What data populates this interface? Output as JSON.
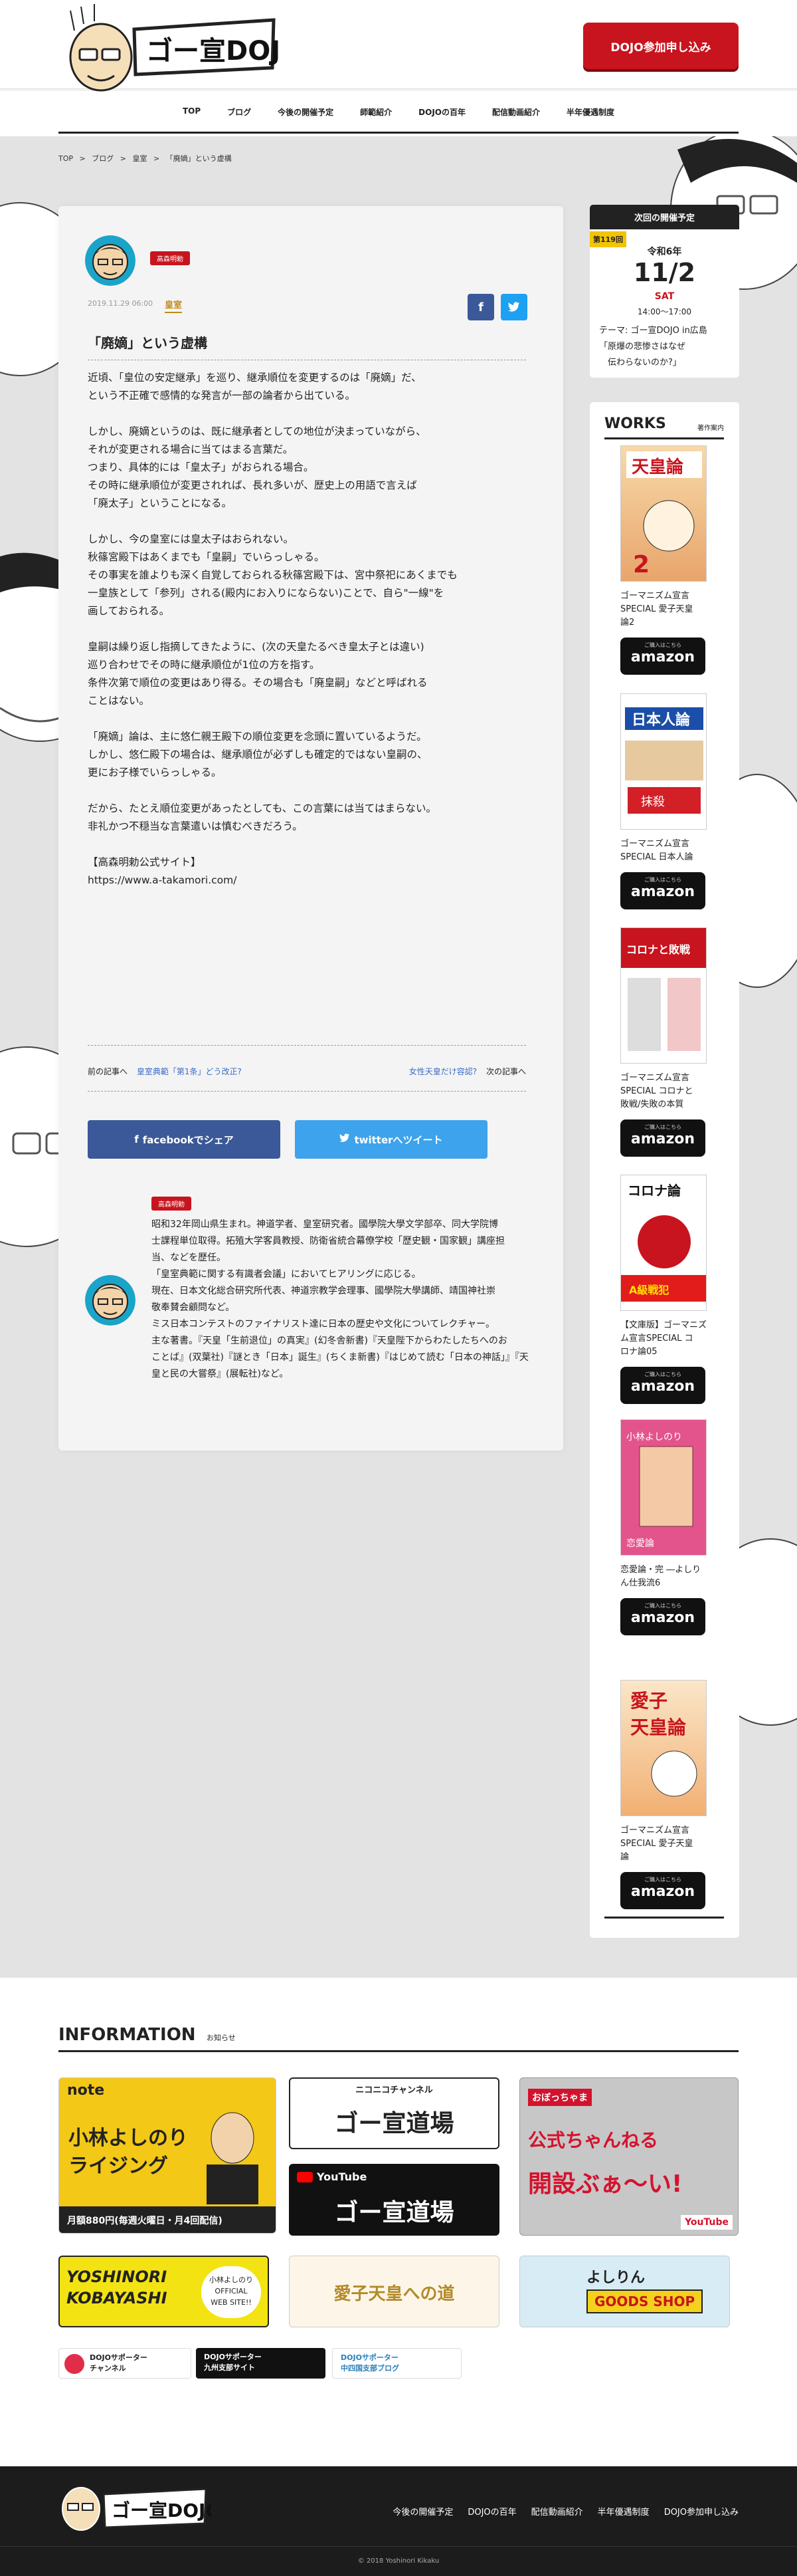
{
  "header": {
    "cta": "DOJO参加申し込み",
    "nav": [
      "TOP",
      "ブログ",
      "今後の開催予定",
      "師範紹介",
      "DOJOの百年",
      "配信動画紹介",
      "半年優遇制度"
    ]
  },
  "breadcrumb": [
    "TOP",
    ">",
    "ブログ",
    ">",
    "皇室",
    ">",
    "「廃嫡」という虚構"
  ],
  "post": {
    "tag": "高森明勅",
    "date": "2019.11.29 06:00",
    "category": "皇室",
    "title": "「廃嫡」という虚構",
    "paragraphs": [
      "近頃、「皇位の安定継承」を巡り、継承順位を変更するのは「廃嫡」だ、\nという不正確で感情的な発言が一部の論者から出ている。",
      "しかし、廃嫡というのは、既に継承者としての地位が決まっていながら、\nそれが変更される場合に当てはまる言葉だ。\nつまり、具体的には「皇太子」がおられる場合。\nその時に継承順位が変更されれば、長れ多いが、歴史上の用語で言えば\n「廃太子」ということになる。",
      "しかし、今の皇室には皇太子はおられない。\n秋篠宮殿下はあくまでも「皇嗣」でいらっしゃる。\nその事実を誰よりも深く自覚しておられる秋篠宮殿下は、宮中祭祀にあくまでも\n一皇族として「参列」される(殿内にお入りにならない)ことで、自ら\"一線\"を\n画しておられる。",
      "皇嗣は繰り返し指摘してきたように、(次の天皇たるべき皇太子とは違い)\n巡り合わせでその時に継承順位が1位の方を指す。\n条件次第で順位の変更はあり得る。その場合も「廃皇嗣」などと呼ばれる\nことはない。",
      "「廃嫡」論は、主に悠仁親王殿下の順位変更を念頭に置いているようだ。\nしかし、悠仁殿下の場合は、継承順位が必ずしも確定的ではない皇嗣の、\n更にお子様でいらっしゃる。",
      "だから、たとえ順位変更があったとしても、この言葉には当てはまらない。\n非礼かつ不穏当な言葉遣いは慎むべきだろう。",
      "【高森明勅公式サイト】\nhttps://www.a-takamori.com/"
    ],
    "prev_label": "前の記事へ",
    "prev_link": "皇室典範「第1条」どう改正?",
    "next_link": "女性天皇だけ容認?",
    "next_label": "次の記事へ",
    "share_fb": "facebookでシェア",
    "share_tw": "twitterへツイート",
    "author_tag": "高森明勅",
    "author_bio": "昭和32年岡山県生まれ。神道学者、皇室研究者。國學院大學文学部卒、同大学院博\n士課程単位取得。拓殖大学客員教授、防衛省統合幕僚学校「歴史観・国家観」講座担\n当、などを歴任。\n「皇室典範に関する有識者会議」においてヒアリングに応じる。\n現在、日本文化総合研究所代表、神道宗教学会理事、國學院大學講師、靖国神社崇\n敬奉賛会顧問など。\nミス日本コンテストのファイナリスト達に日本の歴史や文化についてレクチャー。\n主な著書。『天皇「生前退位」の真実』(幻冬舎新書)『天皇陛下からわたしたちへのお\nことば』(双葉社)『謎とき「日本」誕生』(ちくま新書)『はじめて読む「日本の神話」』『天\n皇と民の大嘗祭』(展転社)など。"
  },
  "next_event": {
    "header": "次回の開催予定",
    "badge": "第119回",
    "era": "令和6年",
    "date": "11/2",
    "dow": "SAT",
    "time": "14:00〜17:00",
    "theme": "テーマ: ゴー宣DOJO in広島\n「原爆の悲惨さはなぜ\n　伝わらないのか?」"
  },
  "works": {
    "title": "WORKS",
    "sub": "著作案内",
    "amazon_small": "ご購入はこちら",
    "amazon": "amazon",
    "books": [
      {
        "caption": "ゴーマニズム宣言\nSPECIAL 愛子天皇\n論2"
      },
      {
        "caption": "ゴーマニズム宣言\nSPECIAL 日本人論"
      },
      {
        "caption": "ゴーマニズム宣言\nSPECIAL コロナと\n敗戦/失敗の本質"
      },
      {
        "caption": "【文庫版】ゴーマニズ\nム宣言SPECIAL コ\nロナ論05"
      },
      {
        "caption": "恋愛論・完 ―よしり\nん仕我流6"
      },
      {
        "caption": "ゴーマニズム宣言\nSPECIAL 愛子天皇\n論"
      }
    ]
  },
  "information": {
    "title": "INFORMATION",
    "sub": "お知らせ",
    "note": "note",
    "note_title": "小林よしのり\nライジング",
    "note_price": "月額880円(毎週火曜日・月4回配信)",
    "nico": "ニコニコチャンネル",
    "youtube": "YouTube",
    "dojo_name": "ゴー宣道場",
    "chan_line1": "おぼっちゃま",
    "chan_line2": "公式ちゃんねる",
    "chan_line3": "開設ぶぁ〜い!",
    "yoshinori": "YOSHINORI\nKOBAYASHI",
    "official": "小林よしのり\nOFFICIAL\nWEB SITE!!",
    "aiko": "愛子天皇への道",
    "goods": "よしりん",
    "goods2": "GOODS SHOP",
    "b1": "DOJOサポーター\nチャンネル",
    "b2": "DOJOサポーター\n九州支部サイト",
    "b3": "DOJOサポーター\n中四国支部ブログ"
  },
  "footer": {
    "nav": [
      "今後の開催予定",
      "DOJOの百年",
      "配信動画紹介",
      "半年優遇制度",
      "DOJO参加申し込み"
    ],
    "copy": "© 2018 Yoshinori Kikaku"
  }
}
